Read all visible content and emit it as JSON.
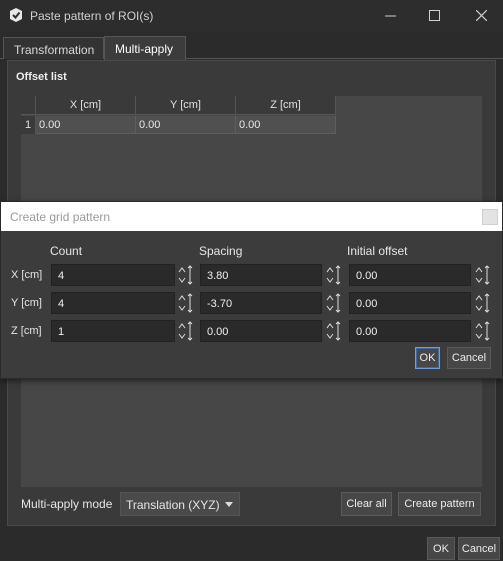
{
  "window": {
    "title": "Paste pattern of ROI(s)"
  },
  "tabs": [
    {
      "label": "Transformation"
    },
    {
      "label": "Multi-apply"
    }
  ],
  "offset_list": {
    "title": "Offset list",
    "headers": [
      "X [cm]",
      "Y [cm]",
      "Z [cm]"
    ],
    "rows": [
      {
        "index": "1",
        "x": "0.00",
        "y": "0.00",
        "z": "0.00"
      }
    ]
  },
  "mode": {
    "label": "Multi-apply mode",
    "value": "Translation (XYZ)"
  },
  "buttons": {
    "clear_all": "Clear all",
    "create_pattern": "Create pattern",
    "ok": "OK",
    "cancel": "Cancel"
  },
  "dialog": {
    "title": "Create grid pattern",
    "columns": {
      "count": "Count",
      "spacing": "Spacing",
      "offset": "Initial offset"
    },
    "rows": [
      {
        "label": "X [cm]",
        "count": "4",
        "spacing": "3.80",
        "offset": "0.00"
      },
      {
        "label": "Y [cm]",
        "count": "4",
        "spacing": "-3.70",
        "offset": "0.00"
      },
      {
        "label": "Z [cm]",
        "count": "1",
        "spacing": "0.00",
        "offset": "0.00"
      }
    ],
    "ok": "OK",
    "cancel": "Cancel"
  }
}
